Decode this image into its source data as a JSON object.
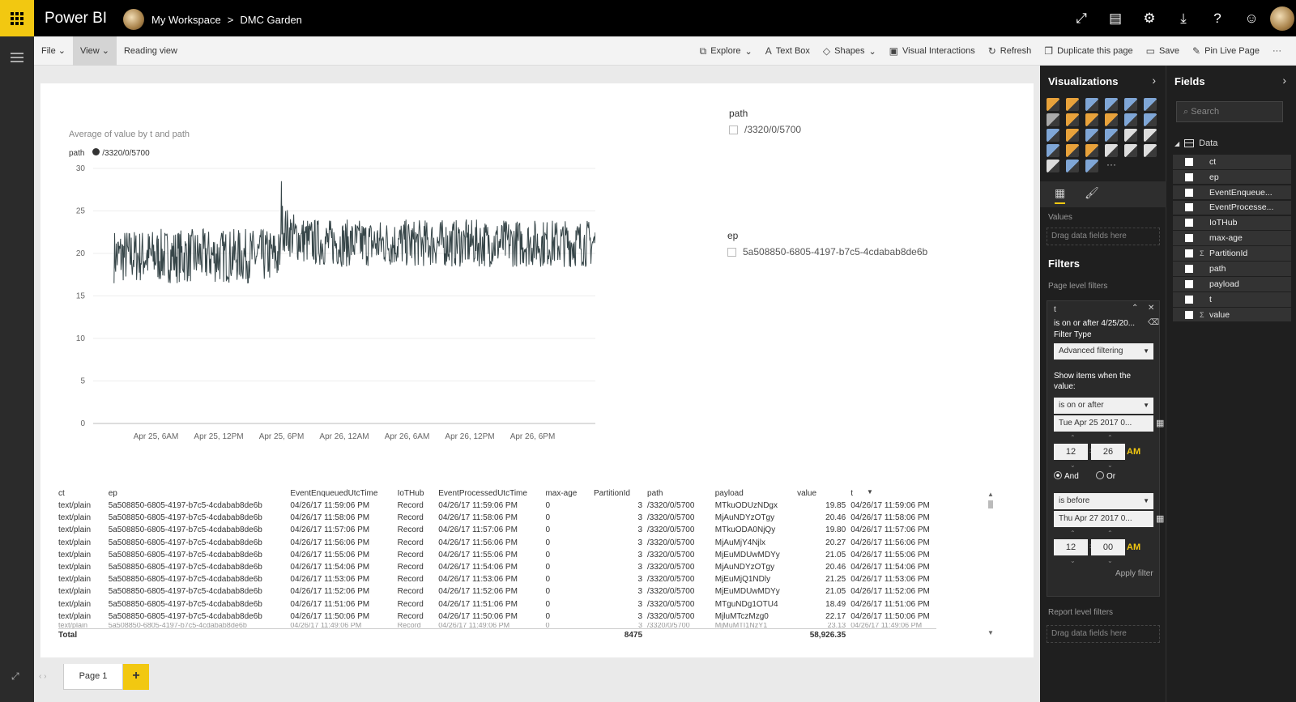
{
  "topbar": {
    "brand": "Power BI",
    "breadcrumb": [
      "My Workspace",
      "DMC Garden"
    ],
    "separator": ">",
    "icons": [
      "expand-icon",
      "comment-icon",
      "gear-icon",
      "download-icon",
      "help-icon",
      "smiley-icon"
    ],
    "user_avatar": "avatar"
  },
  "toolbar": {
    "left": [
      {
        "label": "File",
        "caret": true
      },
      {
        "label": "View",
        "caret": true,
        "active": true
      },
      {
        "label": "Reading view",
        "caret": false
      }
    ],
    "right": [
      {
        "label": "Explore",
        "icon": "explore-icon",
        "caret": true
      },
      {
        "label": "Text Box",
        "icon": "textbox-icon",
        "caret": false
      },
      {
        "label": "Shapes",
        "icon": "shapes-icon",
        "caret": true
      },
      {
        "label": "Visual Interactions",
        "icon": "interactions-icon",
        "caret": false
      },
      {
        "label": "Refresh",
        "icon": "refresh-icon",
        "caret": false
      },
      {
        "label": "Duplicate this page",
        "icon": "duplicate-icon",
        "caret": false
      },
      {
        "label": "Save",
        "icon": "save-icon",
        "caret": false
      },
      {
        "label": "Pin Live Page",
        "icon": "pin-icon",
        "caret": false
      },
      {
        "label": "···",
        "icon": "",
        "caret": false
      }
    ]
  },
  "chart_data": {
    "type": "line",
    "title": "Average of value by t and path",
    "legend_title": "path",
    "series": [
      {
        "name": "/3320/0/5700",
        "color": "#374649"
      }
    ],
    "x_ticks": [
      "Apr 25, 6AM",
      "Apr 25, 12PM",
      "Apr 25, 6PM",
      "Apr 26, 12AM",
      "Apr 26, 6AM",
      "Apr 26, 12PM",
      "Apr 26, 6PM"
    ],
    "x": [
      "2017-04-25T02:00",
      "2017-04-25T06:00",
      "2017-04-25T12:00",
      "2017-04-25T17:30",
      "2017-04-25T18:00",
      "2017-04-25T18:30",
      "2017-04-26T00:00",
      "2017-04-26T06:00",
      "2017-04-26T12:00",
      "2017-04-26T18:00",
      "2017-04-26T23:59"
    ],
    "y": [
      19.5,
      19.8,
      20.0,
      19.6,
      28.5,
      22.5,
      21.8,
      21.3,
      21.0,
      21.0,
      21.0
    ],
    "noise_band": {
      "before_jump": [
        16.5,
        23
      ],
      "after_jump": [
        18.5,
        24.5
      ]
    },
    "y_ticks": [
      0,
      5,
      10,
      15,
      20,
      25,
      30
    ],
    "ylim": [
      0,
      30
    ],
    "grid": true
  },
  "slicers": [
    {
      "title": "path",
      "item": "/3320/0/5700"
    },
    {
      "title": "ep",
      "item": "5a508850-6805-4197-b7c5-4cdabab8de6b"
    }
  ],
  "table": {
    "columns": [
      "ct",
      "ep",
      "EventEnqueuedUtcTime",
      "IoTHub",
      "EventProcessedUtcTime",
      "max-age",
      "PartitionId",
      "path",
      "payload",
      "value",
      "t"
    ],
    "rows": [
      [
        "text/plain",
        "5a508850-6805-4197-b7c5-4cdabab8de6b",
        "04/26/17 11:59:06 PM",
        "Record",
        "04/26/17 11:59:06 PM",
        "0",
        "3",
        "/3320/0/5700",
        "MTkuODUzNDgx",
        "19.85",
        "04/26/17 11:59:06 PM"
      ],
      [
        "text/plain",
        "5a508850-6805-4197-b7c5-4cdabab8de6b",
        "04/26/17 11:58:06 PM",
        "Record",
        "04/26/17 11:58:06 PM",
        "0",
        "3",
        "/3320/0/5700",
        "MjAuNDYzOTgy",
        "20.46",
        "04/26/17 11:58:06 PM"
      ],
      [
        "text/plain",
        "5a508850-6805-4197-b7c5-4cdabab8de6b",
        "04/26/17 11:57:06 PM",
        "Record",
        "04/26/17 11:57:06 PM",
        "0",
        "3",
        "/3320/0/5700",
        "MTkuODA0NjQy",
        "19.80",
        "04/26/17 11:57:06 PM"
      ],
      [
        "text/plain",
        "5a508850-6805-4197-b7c5-4cdabab8de6b",
        "04/26/17 11:56:06 PM",
        "Record",
        "04/26/17 11:56:06 PM",
        "0",
        "3",
        "/3320/0/5700",
        "MjAuMjY4Njlx",
        "20.27",
        "04/26/17 11:56:06 PM"
      ],
      [
        "text/plain",
        "5a508850-6805-4197-b7c5-4cdabab8de6b",
        "04/26/17 11:55:06 PM",
        "Record",
        "04/26/17 11:55:06 PM",
        "0",
        "3",
        "/3320/0/5700",
        "MjEuMDUwMDYy",
        "21.05",
        "04/26/17 11:55:06 PM"
      ],
      [
        "text/plain",
        "5a508850-6805-4197-b7c5-4cdabab8de6b",
        "04/26/17 11:54:06 PM",
        "Record",
        "04/26/17 11:54:06 PM",
        "0",
        "3",
        "/3320/0/5700",
        "MjAuNDYzOTgy",
        "20.46",
        "04/26/17 11:54:06 PM"
      ],
      [
        "text/plain",
        "5a508850-6805-4197-b7c5-4cdabab8de6b",
        "04/26/17 11:53:06 PM",
        "Record",
        "04/26/17 11:53:06 PM",
        "0",
        "3",
        "/3320/0/5700",
        "MjEuMjQ1NDly",
        "21.25",
        "04/26/17 11:53:06 PM"
      ],
      [
        "text/plain",
        "5a508850-6805-4197-b7c5-4cdabab8de6b",
        "04/26/17 11:52:06 PM",
        "Record",
        "04/26/17 11:52:06 PM",
        "0",
        "3",
        "/3320/0/5700",
        "MjEuMDUwMDYy",
        "21.05",
        "04/26/17 11:52:06 PM"
      ],
      [
        "text/plain",
        "5a508850-6805-4197-b7c5-4cdabab8de6b",
        "04/26/17 11:51:06 PM",
        "Record",
        "04/26/17 11:51:06 PM",
        "0",
        "3",
        "/3320/0/5700",
        "MTguNDg1OTU4",
        "18.49",
        "04/26/17 11:51:06 PM"
      ],
      [
        "text/plain",
        "5a508850-6805-4197-b7c5-4cdabab8de6b",
        "04/26/17 11:50:06 PM",
        "Record",
        "04/26/17 11:50:06 PM",
        "0",
        "3",
        "/3320/0/5700",
        "MjluMTczMzg0",
        "22.17",
        "04/26/17 11:50:06 PM"
      ]
    ],
    "partial_row": [
      "text/plain",
      "5a508850-6805-4197-b7c5-4cdabab8de6b",
      "04/26/17 11:49:06 PM",
      "Record",
      "04/26/17 11:49:06 PM",
      "0",
      "3",
      "/3320/0/5700",
      "MjMuMTI1NzY1",
      "23.13",
      "04/26/17 11:49:06 PM"
    ],
    "total": {
      "label": "Total",
      "partition": "8475",
      "value": "58,926.35"
    }
  },
  "pages": {
    "tab": "Page 1",
    "add": "+"
  },
  "visualizations": {
    "title": "Visualizations",
    "icons": [
      "#e8a23b",
      "#e8a23b",
      "#7fa6d6",
      "#7fa6d6",
      "#7fa6d6",
      "#7fa6d6",
      "#aaa",
      "#e8a23b",
      "#e8a23b",
      "#e8a23b",
      "#7fa6d6",
      "#7fa6d6",
      "#7fa6d6",
      "#e8a23b",
      "#7fa6d6",
      "#7fa6d6",
      "#ddd",
      "#ddd",
      "#7fa6d6",
      "#e8a23b",
      "#e8a23b",
      "#ddd",
      "#ddd",
      "#ddd",
      "#ddd",
      "#7fa6d6",
      "#7fa6d6",
      "more"
    ],
    "values_label": "Values",
    "drop_hint": "Drag data fields here"
  },
  "filters": {
    "title": "Filters",
    "page_level": "Page level filters",
    "card": {
      "field": "t",
      "summary": "is on or after 4/25/20...",
      "filter_type_label": "Filter Type",
      "filter_type": "Advanced filtering",
      "show_items": "Show items when the value:",
      "cond1": "is on or after",
      "date1": "Tue Apr 25 2017 0...",
      "hour1": "12",
      "min1": "26",
      "ampm1": "AM",
      "and_label": "And",
      "or_label": "Or",
      "cond2": "is before",
      "date2": "Thu Apr 27 2017 0...",
      "hour2": "12",
      "min2": "00",
      "ampm2": "AM",
      "apply": "Apply filter"
    },
    "report_level": "Report level filters",
    "drop_hint": "Drag data fields here"
  },
  "fields": {
    "title": "Fields",
    "search_placeholder": "Search",
    "table_name": "Data",
    "items": [
      {
        "name": "ct",
        "sigma": false
      },
      {
        "name": "ep",
        "sigma": false
      },
      {
        "name": "EventEnqueue...",
        "sigma": false
      },
      {
        "name": "EventProcesse...",
        "sigma": false
      },
      {
        "name": "IoTHub",
        "sigma": false
      },
      {
        "name": "max-age",
        "sigma": false
      },
      {
        "name": "PartitionId",
        "sigma": true
      },
      {
        "name": "path",
        "sigma": false
      },
      {
        "name": "payload",
        "sigma": false
      },
      {
        "name": "t",
        "sigma": false
      },
      {
        "name": "value",
        "sigma": true
      }
    ]
  }
}
